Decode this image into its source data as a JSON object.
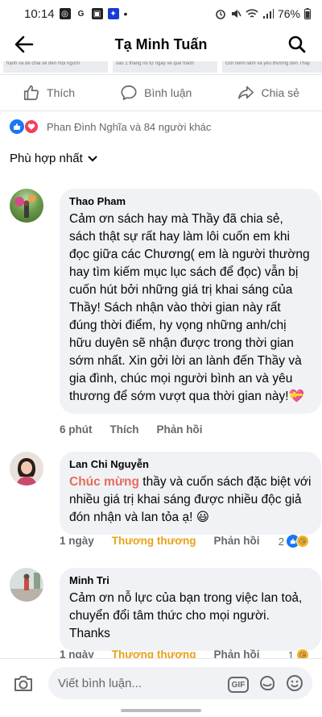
{
  "status": {
    "time": "10:14",
    "battery": "76%",
    "icons": [
      "G"
    ]
  },
  "header": {
    "title": "Tạ Minh Tuấn"
  },
  "thumbs": [
    "hạnh và dễ chia sẻ đến mọi người",
    "sau 1 tháng rồi tự ngày về quê tranh",
    "Gửi niềm lành và yêu thương đến Thầy"
  ],
  "actions": {
    "like": "Thích",
    "comment": "Bình luận",
    "share": "Chia sẻ"
  },
  "reactions_summary": {
    "text": "Phan Đình Nghĩa và 84 người khác"
  },
  "sort": {
    "label": "Phù hợp nhất"
  },
  "comments": [
    {
      "name": "Thao Pham",
      "text": "Cảm ơn sách hay mà Thầy đã chia sẻ, sách thật sự rất hay làm lôi cuốn em khi đọc giữa các Chương( em là người thường hay tìm kiếm mục lục sách để đọc) vẫn bị cuốn hút bởi những giá trị khai sáng của Thầy! Sách nhận vào thời gian này rất đúng thời điểm, hy vọng những anh/chị hữu duyên sẽ nhận được trong thời gian sớm nhất. Xin gởi lời an lành đến Thầy và gia đình, chúc mọi người bình an và yêu thương để sớm vượt qua thời gian này!💝",
      "time": "6 phút",
      "react_label": "Thích",
      "reply_label": "Phản hồi"
    },
    {
      "name": "Lan Chi Nguyễn",
      "highlight": "Chúc mừng",
      "text": " thầy và cuốn sách đặc biệt với nhiều giá trị khai sáng được nhiều độc giả đón nhận và lan tỏa ạ! 😃",
      "time": "1 ngày",
      "react_label": "Thương thương",
      "reply_label": "Phản hồi",
      "count": "2"
    },
    {
      "name": "Minh Tri",
      "text": "Cảm ơn nỗ lực của bạn trong việc lan toả, chuyển đổi tâm thức cho mọi người. Thanks",
      "time": "1 ngày",
      "react_label": "Thương thương",
      "reply_label": "Phản hồi",
      "count": "1"
    }
  ],
  "composer": {
    "placeholder": "Viết bình luận...",
    "gif": "GIF"
  },
  "colors": {
    "accent": "#1877f2",
    "love": "#f33e58",
    "care": "#e8a21a",
    "bubble": "#f0f2f5",
    "highlight": "#e86c5c"
  }
}
